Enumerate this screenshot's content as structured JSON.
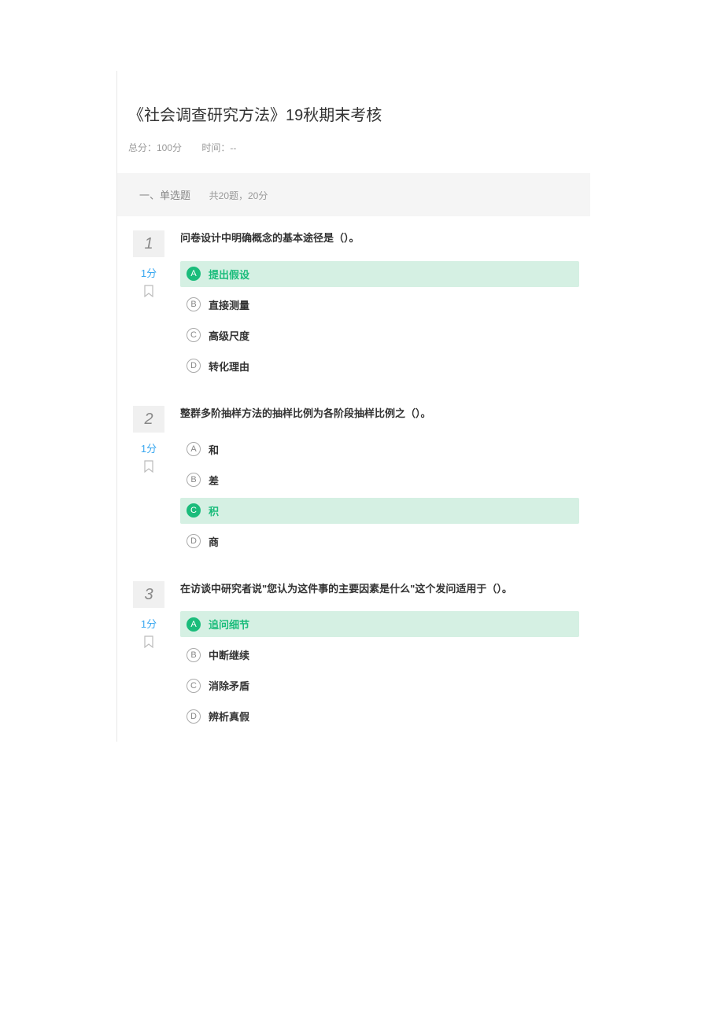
{
  "header": {
    "title": "《社会调查研究方法》19秋期末考核",
    "score_label": "总分：100分",
    "time_label": "时间：--"
  },
  "section": {
    "title": "一、单选题",
    "info": "共20题，20分"
  },
  "questions": [
    {
      "number": "1",
      "score": "1分",
      "bookmark": "▢",
      "text": "问卷设计中明确概念的基本途径是（）。",
      "options": [
        {
          "letter": "A",
          "text": "提出假设",
          "selected": true
        },
        {
          "letter": "B",
          "text": "直接测量",
          "selected": false
        },
        {
          "letter": "C",
          "text": "高级尺度",
          "selected": false
        },
        {
          "letter": "D",
          "text": "转化理由",
          "selected": false
        }
      ]
    },
    {
      "number": "2",
      "score": "1分",
      "bookmark": "▢",
      "text": "整群多阶抽样方法的抽样比例为各阶段抽样比例之（）。",
      "options": [
        {
          "letter": "A",
          "text": "和",
          "selected": false
        },
        {
          "letter": "B",
          "text": "差",
          "selected": false
        },
        {
          "letter": "C",
          "text": "积",
          "selected": true
        },
        {
          "letter": "D",
          "text": "商",
          "selected": false
        }
      ]
    },
    {
      "number": "3",
      "score": "1分",
      "bookmark": "▢",
      "text": "在访谈中研究者说\"您认为这件事的主要因素是什么\"这个发问适用于（）。",
      "options": [
        {
          "letter": "A",
          "text": "追问细节",
          "selected": true
        },
        {
          "letter": "B",
          "text": "中断继续",
          "selected": false
        },
        {
          "letter": "C",
          "text": "消除矛盾",
          "selected": false
        },
        {
          "letter": "D",
          "text": "辨析真假",
          "selected": false
        }
      ]
    }
  ]
}
